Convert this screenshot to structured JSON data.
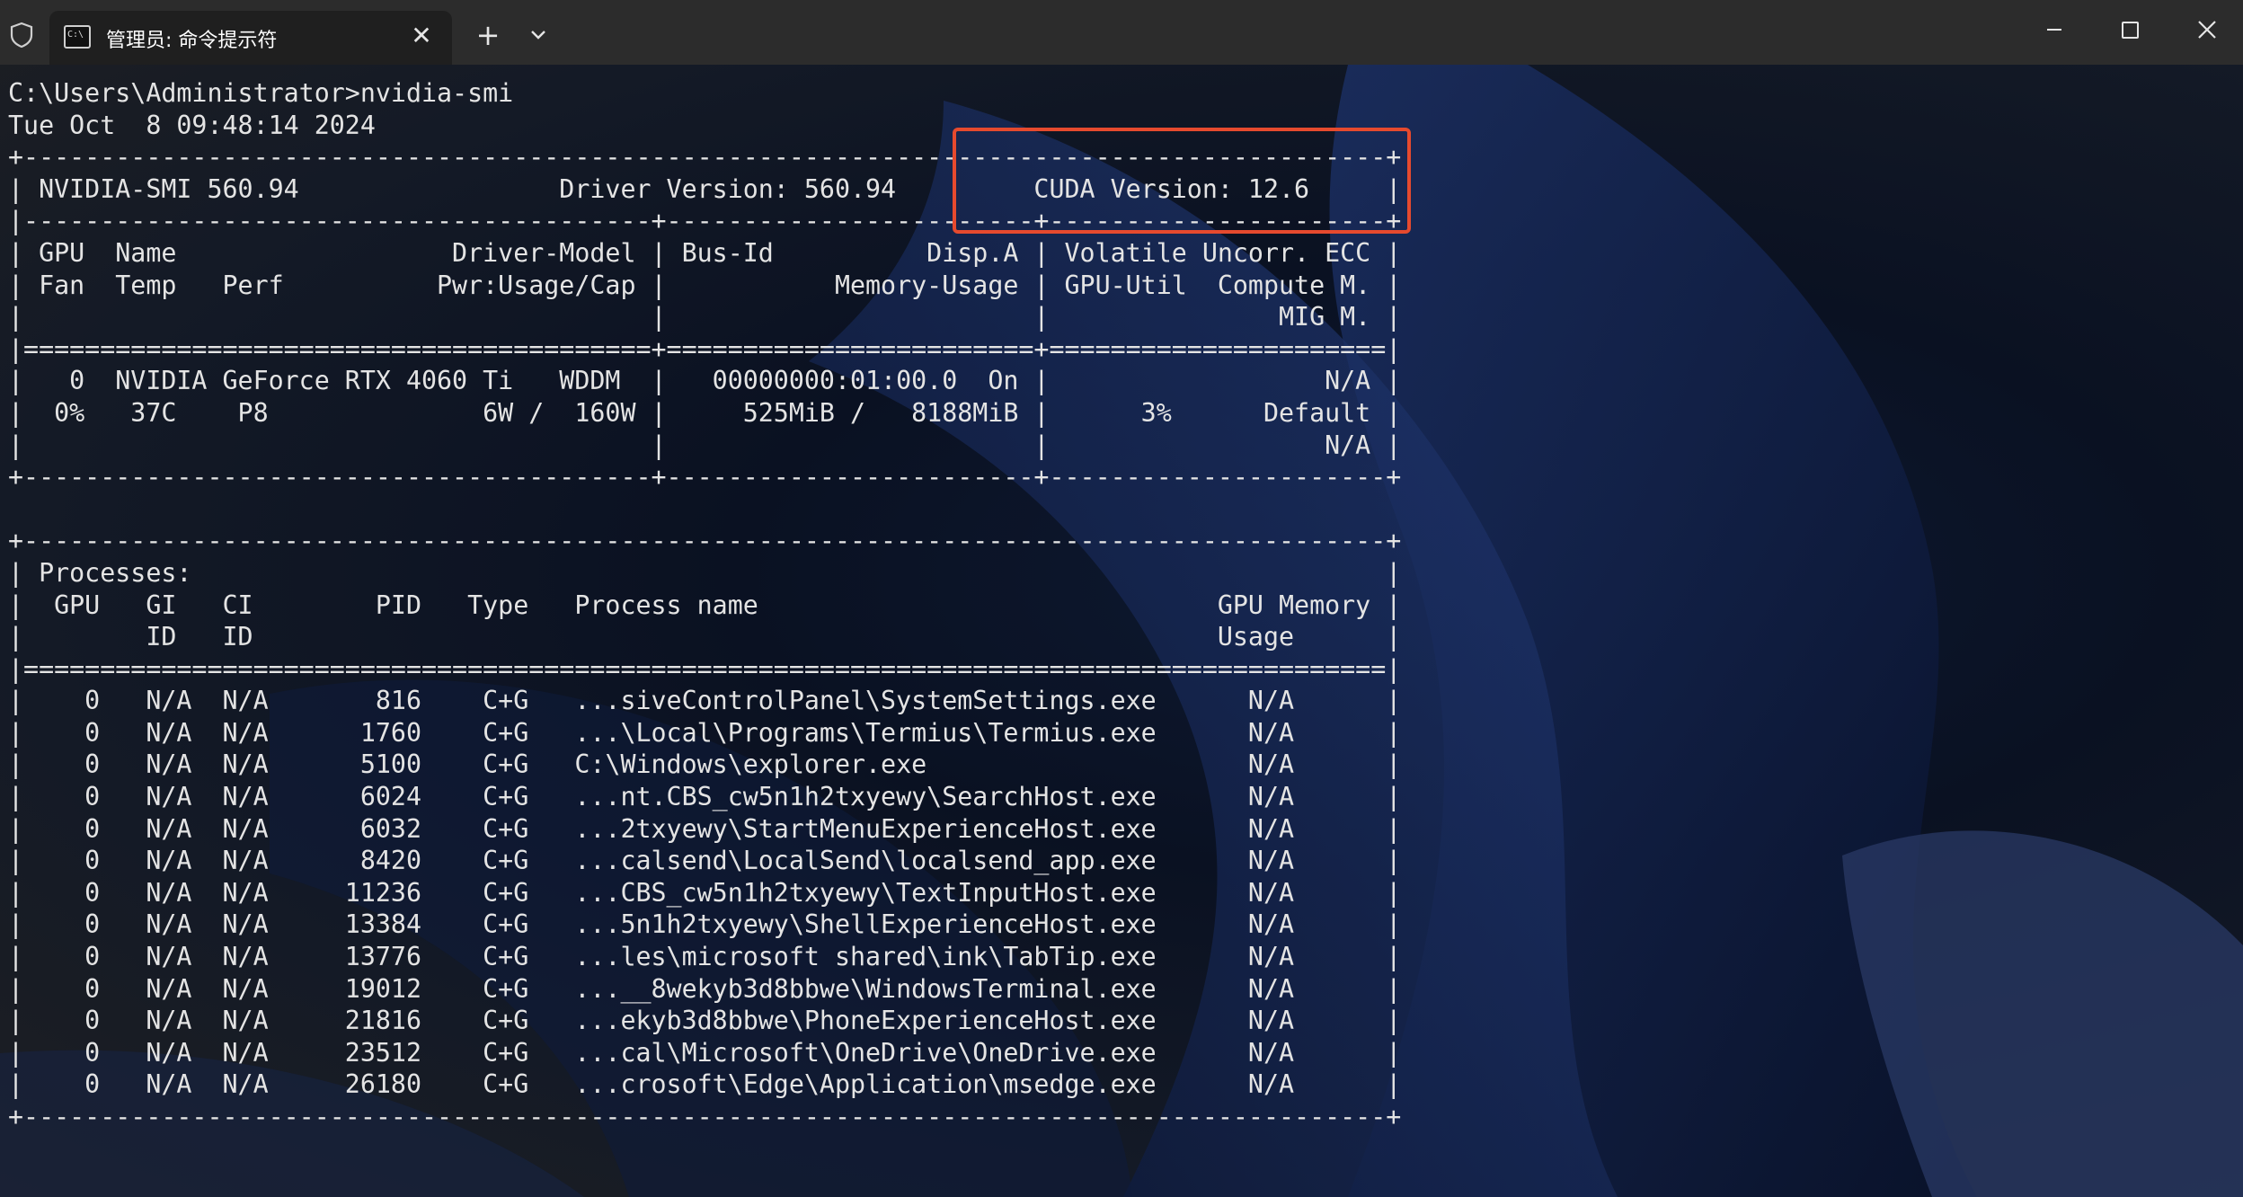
{
  "window": {
    "tab_title": "管理员: 命令提示符",
    "tab_icon_glyph": "C:\\",
    "tab_close_glyph": "✕",
    "new_tab_glyph": "+",
    "icons": [
      "shield-icon",
      "terminal-icon",
      "close-icon",
      "plus-icon",
      "chevron-down-icon",
      "minimize-icon",
      "maximize-icon",
      "close-window-icon"
    ]
  },
  "terminal": {
    "lines": [
      "C:\\Users\\Administrator>nvidia-smi",
      "Tue Oct  8 09:48:14 2024",
      "+-----------------------------------------------------------------------------------------+",
      "| NVIDIA-SMI 560.94                 Driver Version: 560.94         CUDA Version: 12.6     |",
      "|-----------------------------------------+------------------------+----------------------+",
      "| GPU  Name                  Driver-Model | Bus-Id          Disp.A | Volatile Uncorr. ECC |",
      "| Fan  Temp   Perf          Pwr:Usage/Cap |           Memory-Usage | GPU-Util  Compute M. |",
      "|                                         |                        |               MIG M. |",
      "|=========================================+========================+======================|",
      "|   0  NVIDIA GeForce RTX 4060 Ti   WDDM  |   00000000:01:00.0  On |                  N/A |",
      "|  0%   37C    P8              6W /  160W |     525MiB /   8188MiB |      3%      Default |",
      "|                                         |                        |                  N/A |",
      "+-----------------------------------------+------------------------+----------------------+",
      "",
      "+-----------------------------------------------------------------------------------------+",
      "| Processes:                                                                              |",
      "|  GPU   GI   CI        PID   Type   Process name                              GPU Memory |",
      "|        ID   ID                                                               Usage      |",
      "|=========================================================================================|",
      "|    0   N/A  N/A       816    C+G   ...siveControlPanel\\SystemSettings.exe      N/A      |",
      "|    0   N/A  N/A      1760    C+G   ...\\Local\\Programs\\Termius\\Termius.exe      N/A      |",
      "|    0   N/A  N/A      5100    C+G   C:\\Windows\\explorer.exe                     N/A      |",
      "|    0   N/A  N/A      6024    C+G   ...nt.CBS_cw5n1h2txyewy\\SearchHost.exe      N/A      |",
      "|    0   N/A  N/A      6032    C+G   ...2txyewy\\StartMenuExperienceHost.exe      N/A      |",
      "|    0   N/A  N/A      8420    C+G   ...calsend\\LocalSend\\localsend_app.exe      N/A      |",
      "|    0   N/A  N/A     11236    C+G   ...CBS_cw5n1h2txyewy\\TextInputHost.exe      N/A      |",
      "|    0   N/A  N/A     13384    C+G   ...5n1h2txyewy\\ShellExperienceHost.exe      N/A      |",
      "|    0   N/A  N/A     13776    C+G   ...les\\microsoft shared\\ink\\TabTip.exe      N/A      |",
      "|    0   N/A  N/A     19012    C+G   ...__8wekyb3d8bbwe\\WindowsTerminal.exe      N/A      |",
      "|    0   N/A  N/A     21816    C+G   ...ekyb3d8bbwe\\PhoneExperienceHost.exe      N/A      |",
      "|    0   N/A  N/A     23512    C+G   ...cal\\Microsoft\\OneDrive\\OneDrive.exe      N/A      |",
      "|    0   N/A  N/A     26180    C+G   ...crosoft\\Edge\\Application\\msedge.exe      N/A      |",
      "+-----------------------------------------------------------------------------------------+"
    ]
  },
  "annotation": {
    "highlight_color": "#e64a2e"
  },
  "colors": {
    "titlebar": "#2c2c2c",
    "active_tab": "#1f1f1f",
    "terminal_text": "#e4e4e4"
  }
}
